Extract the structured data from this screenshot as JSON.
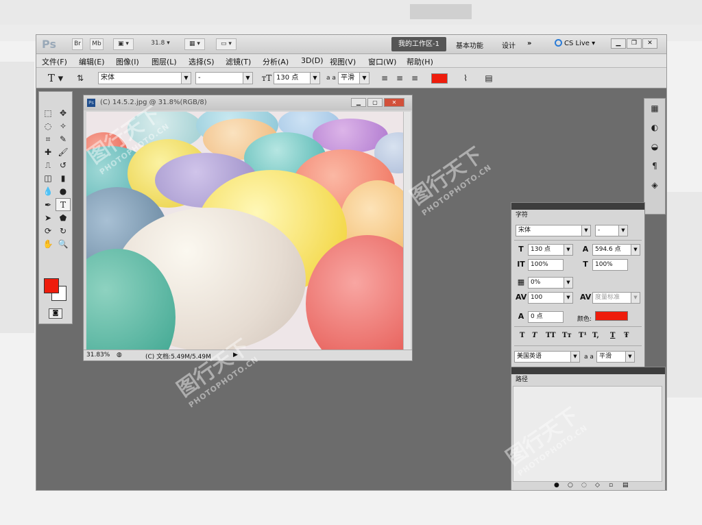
{
  "app": {
    "logo": "Ps",
    "zoom": "31.8",
    "workspaces": {
      "active": "我的工作区-1",
      "basic": "基本功能",
      "design": "设计",
      "more": "»"
    },
    "cs_live": "CS Live"
  },
  "menu": [
    "文件(F)",
    "编辑(E)",
    "图像(I)",
    "图层(L)",
    "选择(S)",
    "滤镜(T)",
    "分析(A)",
    "3D(D)",
    "视图(V)",
    "窗口(W)",
    "帮助(H)"
  ],
  "options": {
    "font_family": "宋体",
    "font_style": "-",
    "font_size": "130 点",
    "antialias_icon": "a a",
    "antialias": "平滑",
    "text_color": "#ee1c0c"
  },
  "document": {
    "title": "(C) 14.5.2.jpg @ 31.8%(RGB/8)",
    "zoom_status": "31.83%",
    "doc_info": "(C) 文档:5.49M/5.49M"
  },
  "character_panel": {
    "tab": "字符",
    "font_family": "宋体",
    "font_style": "-",
    "size": "130 点",
    "leading": "594.6 点",
    "vertical_scale": "100%",
    "horizontal_scale": "100%",
    "tsume": "0%",
    "tracking": "100",
    "kerning": "度量标准",
    "baseline": "0 点",
    "color_label": "颜色:",
    "color": "#ee1c0c",
    "format_buttons": [
      "T",
      "T",
      "TT",
      "Tт",
      "T¹",
      "T,",
      "T",
      "Ŧ"
    ],
    "language": "美国英语",
    "antialias_icon": "a a",
    "antialias": "平滑"
  },
  "paths_panel": {
    "tab": "路径"
  },
  "watermark": {
    "cn": "图行天下",
    "en": "PHOTOPHOTO.CN"
  }
}
